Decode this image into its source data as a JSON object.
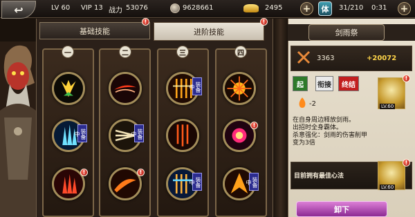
{
  "topbar": {
    "back_icon": "back-arrow-icon",
    "level": "LV 60",
    "vip": "VIP 13",
    "power_label": "战力",
    "power_value": "53076",
    "silver": "9628661",
    "gold": "2495",
    "stamina_icon_label": "体",
    "stamina": "31/210",
    "timer": "0:31"
  },
  "tabs": [
    {
      "label": "基础技能",
      "active": false,
      "alert": "!"
    },
    {
      "label": "进阶技能",
      "active": true,
      "alert": "!"
    }
  ],
  "columns": [
    {
      "num": "一",
      "skills": [
        {
          "icon": "yellow-blades-skill-icon",
          "tag": "",
          "alert": false
        },
        {
          "icon": "blue-crystal-skill-icon",
          "tag": "装备中",
          "alert": false
        },
        {
          "icon": "red-crystal-skill-icon",
          "tag": "",
          "alert": true
        }
      ]
    },
    {
      "num": "二",
      "skills": [
        {
          "icon": "red-slash-skill-icon",
          "tag": "",
          "alert": false
        },
        {
          "icon": "triple-arrow-skill-icon",
          "tag": "装备中",
          "alert": false
        },
        {
          "icon": "flame-slash-skill-icon",
          "tag": "",
          "alert": true
        }
      ]
    },
    {
      "num": "三",
      "skills": [
        {
          "icon": "sword-rain-skill-icon",
          "tag": "装备中",
          "alert": false
        },
        {
          "icon": "falling-swords-skill-icon",
          "tag": "",
          "alert": false
        },
        {
          "icon": "blue-sword-rain-skill-icon",
          "tag": "装备中",
          "alert": false
        }
      ]
    },
    {
      "num": "四",
      "skills": [
        {
          "icon": "sunburst-skill-icon",
          "tag": "",
          "alert": false
        },
        {
          "icon": "explosion-skill-icon",
          "tag": "",
          "alert": true
        },
        {
          "icon": "fire-burst-skill-icon",
          "tag": "装备中",
          "alert": false
        }
      ]
    }
  ],
  "detail": {
    "title": "剑雨祭",
    "attack": "3363",
    "bonus": "+20072",
    "combo": [
      "起",
      "衔接",
      "终结"
    ],
    "cost": "-2",
    "portrait_level": "LV.60",
    "description": [
      "在自身周边释放剑雨。",
      "出招时全身霸体。",
      "杀意强化：剑雨的伤害削甲变为3倍"
    ],
    "mind_text": "目前拥有最佳心法",
    "mind_level": "LV.60",
    "unload_label": "卸下"
  },
  "colors": {
    "accent": "#a38d5a",
    "equip_tag": "#2b2c8f",
    "button": "#b24bb4"
  }
}
